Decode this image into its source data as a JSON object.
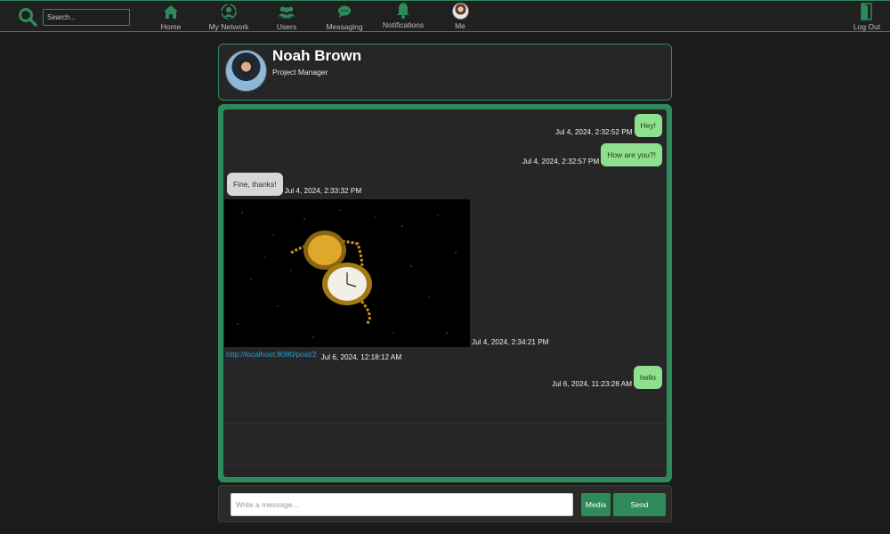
{
  "nav": {
    "search_placeholder": "Search...",
    "items": [
      {
        "label": "Home",
        "icon": "home-icon"
      },
      {
        "label": "My Network",
        "icon": "network-icon"
      },
      {
        "label": "Users",
        "icon": "users-icon"
      },
      {
        "label": "Messaging",
        "icon": "chat-icon"
      },
      {
        "label": "Notifications",
        "icon": "bell-icon"
      },
      {
        "label": "Me",
        "icon": "avatar"
      }
    ],
    "logout_label": "Log Out",
    "accent_color": "#2e8a5a"
  },
  "profile": {
    "name": "Noah Brown",
    "title": "Project Manager"
  },
  "chat": {
    "messages": [
      {
        "from": "me",
        "text": "Hey!",
        "time": "Jul 4, 2024, 2:32:52 PM"
      },
      {
        "from": "me",
        "text": "How are you?!",
        "time": "Jul 4, 2024, 2:32:57 PM"
      },
      {
        "from": "them",
        "text": "Fine, thanks!",
        "time": "Jul 4, 2024, 2:33:32 PM"
      },
      {
        "from": "them",
        "type": "image",
        "image": "pocket-watch-image",
        "time": "Jul 4, 2024, 2:34:21 PM"
      },
      {
        "from": "them",
        "type": "link",
        "text": "http://localhost:8080/post/2",
        "time": "Jul 6, 2024, 12:18:12 AM"
      },
      {
        "from": "me",
        "text": "hello",
        "time": "Jul 6, 2024, 11:23:28 AM"
      }
    ]
  },
  "composer": {
    "placeholder": "Write a message...",
    "media_label": "Media",
    "send_label": "Send"
  }
}
